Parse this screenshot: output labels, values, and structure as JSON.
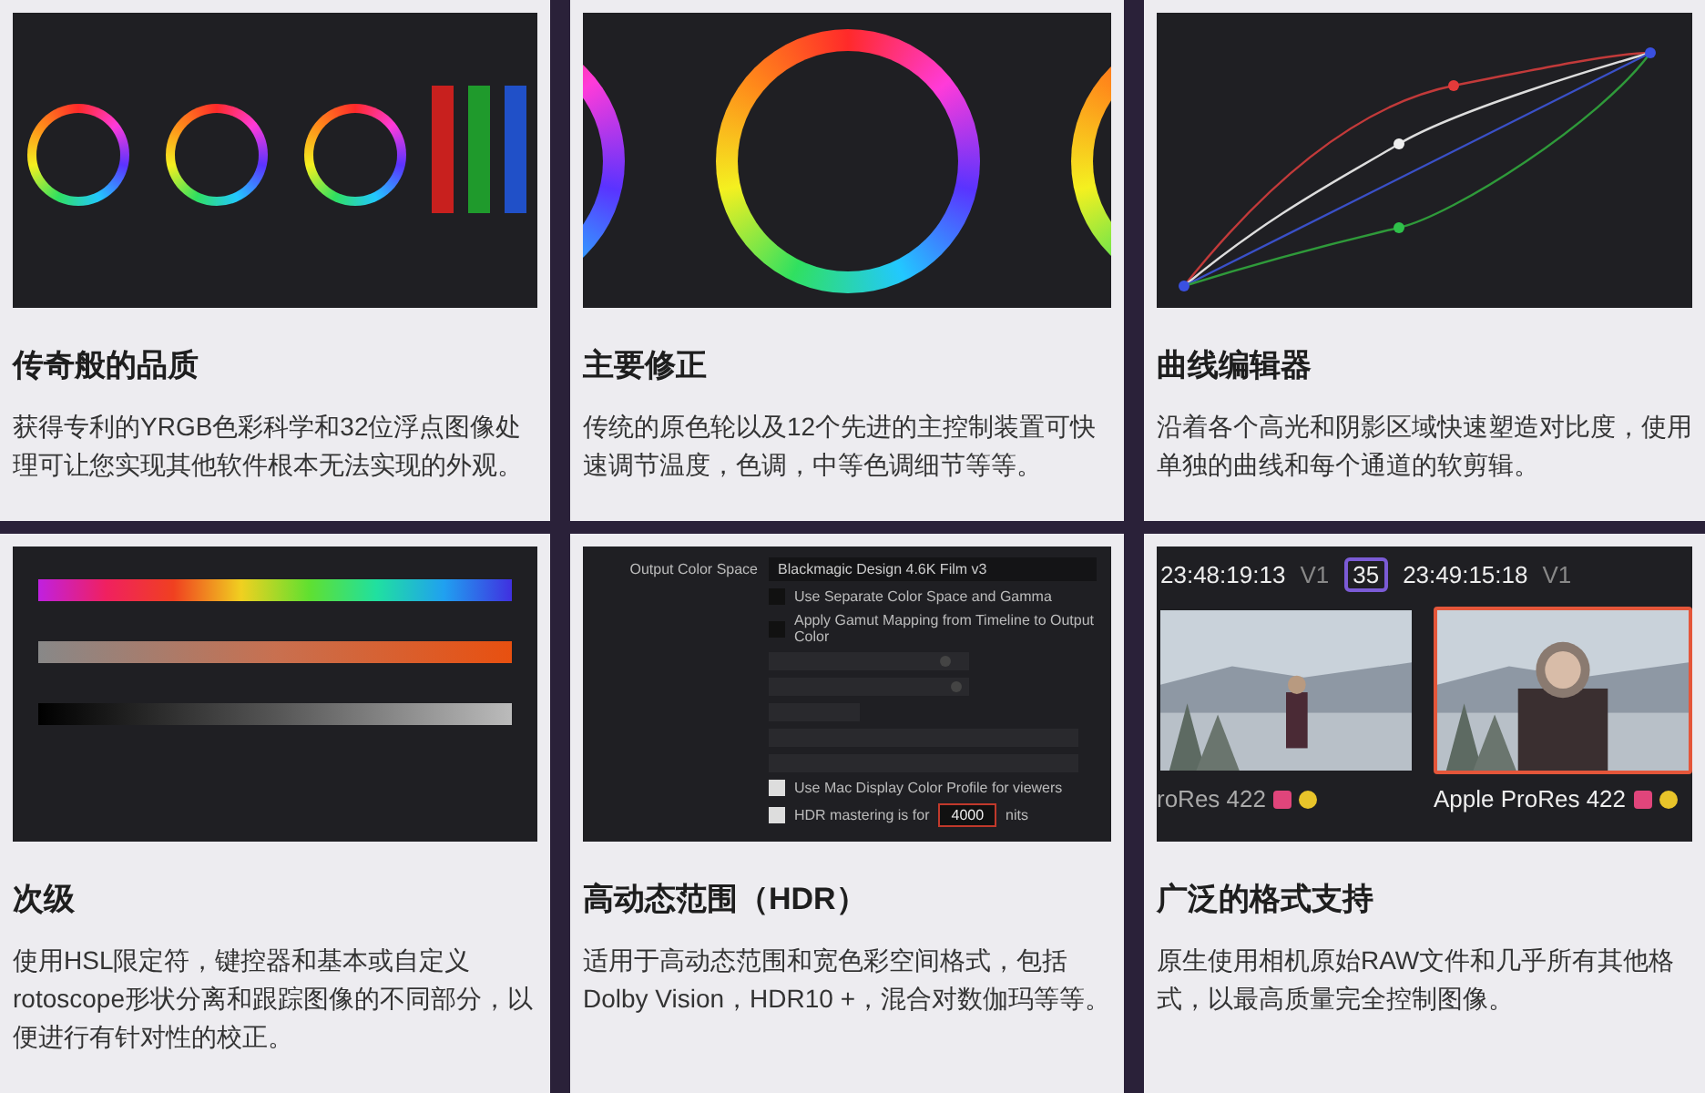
{
  "cards": [
    {
      "title": "传奇般的品质",
      "description": "获得专利的YRGB色彩科学和32位浮点图像处理可让您实现其他软件根本无法实现的外观。",
      "preview": {
        "kind": "wheels"
      }
    },
    {
      "title": "主要修正",
      "description": "传统的原色轮以及12个先进的主控制装置可快速调节温度，色调，中等色调细节等等。",
      "preview": {
        "kind": "primary"
      }
    },
    {
      "title": "曲线编辑器",
      "description": "沿着各个高光和阴影区域快速塑造对比度，使用单独的曲线和每个通道的软剪辑。",
      "preview": {
        "kind": "curves"
      }
    },
    {
      "title": "次级",
      "description": "使用HSL限定符，键控器和基本或自定义rotoscope形状分离和跟踪图像的不同部分，以便进行有针对性的校正。",
      "preview": {
        "kind": "qualifier"
      }
    },
    {
      "title": "高动态范围（HDR）",
      "description": "适用于高动态范围和宽色彩空间格式，包括Dolby Vision，HDR10 +，混合对数伽玛等等。",
      "preview": {
        "kind": "hdr",
        "output_label": "Output Color Space",
        "output_value": "Blackmagic Design 4.6K Film v3",
        "options": [
          {
            "label": "Use Separate Color Space and Gamma",
            "checked": false
          },
          {
            "label": "Apply Gamut Mapping from Timeline to Output Color",
            "checked": false
          }
        ],
        "sliders": [
          {
            "level": 0.9,
            "disabled": true
          },
          {
            "level": 0.96,
            "disabled": true
          }
        ],
        "checks": [
          {
            "label": "Use Mac Display Color Profile for viewers",
            "checked": true
          },
          {
            "label": "HDR mastering is for",
            "checked": true
          }
        ],
        "nits_value": "4000",
        "nits_unit": "nits"
      }
    },
    {
      "title": "广泛的格式支持",
      "description": "原生使用相机原始RAW文件和几乎所有其他格式，以最高质量完全控制图像。",
      "preview": {
        "kind": "formats",
        "badge": "35",
        "clips": [
          {
            "timecode": "23:48:19:13",
            "track": "V1",
            "codec": "roRes 422",
            "selected": false
          },
          {
            "timecode": "23:49:15:18",
            "track": "V1",
            "codec": "Apple ProRes 422",
            "selected": true
          }
        ]
      }
    }
  ]
}
